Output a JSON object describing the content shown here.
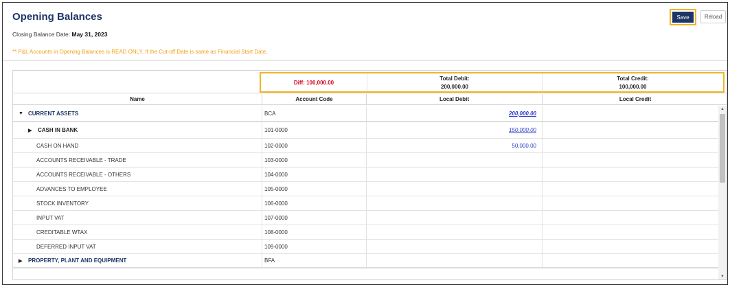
{
  "header": {
    "title": "Opening Balances",
    "closing_label": "Closing Balance Date:",
    "closing_value": "May 31, 2023",
    "note": "** P&L Accounts in Opening Balances is READ ONLY. If the Cut-off Date is same as Financial Start Date.",
    "save_label": "Save",
    "reload_label": "Reload"
  },
  "summary": {
    "diff": "Diff: 100,000.00",
    "total_debit_label": "Total Debit:",
    "total_debit_value": "200,000.00",
    "total_credit_label": "Total Credit:",
    "total_credit_value": "100,000.00"
  },
  "columns": {
    "name": "Name",
    "code": "Account Code",
    "debit": "Local Debit",
    "credit": "Local Credit"
  },
  "rows": [
    {
      "name": "CURRENT ASSETS",
      "code": "BCA",
      "debit": "200,000.00",
      "credit": "",
      "level": 0,
      "caret": "▼"
    },
    {
      "name": "CASH IN BANK",
      "code": "101-0000",
      "debit": "150,000.00",
      "credit": "",
      "level": 1,
      "caret": "▶"
    },
    {
      "name": "CASH ON HAND",
      "code": "102-0000",
      "debit": "50,000.00",
      "credit": "",
      "level": 2
    },
    {
      "name": "ACCOUNTS RECEIVABLE - TRADE",
      "code": "103-0000",
      "debit": "",
      "credit": "",
      "level": 2
    },
    {
      "name": "ACCOUNTS RECEIVABLE - OTHERS",
      "code": "104-0000",
      "debit": "",
      "credit": "",
      "level": 2
    },
    {
      "name": "ADVANCES TO EMPLOYEE",
      "code": "105-0000",
      "debit": "",
      "credit": "",
      "level": 2
    },
    {
      "name": "STOCK INVENTORY",
      "code": "106-0000",
      "debit": "",
      "credit": "",
      "level": 2
    },
    {
      "name": "INPUT VAT",
      "code": "107-0000",
      "debit": "",
      "credit": "",
      "level": 2
    },
    {
      "name": "CREDITABLE WTAX",
      "code": "108-0000",
      "debit": "",
      "credit": "",
      "level": 2
    },
    {
      "name": "DEFERRED INPUT VAT",
      "code": "109-0000",
      "debit": "",
      "credit": "",
      "level": 2
    },
    {
      "name": "PROPERTY, PLANT AND EQUIPMENT",
      "code": "BFA",
      "debit": "",
      "credit": "",
      "level": 0,
      "caret": "▶"
    }
  ],
  "scroll": {
    "up": "▲",
    "down": "▼"
  },
  "colors": {
    "brand": "#1d3566",
    "highlight": "#f0b429",
    "diff": "#d0021b",
    "link": "#2a39c9",
    "note": "#f0a218"
  }
}
